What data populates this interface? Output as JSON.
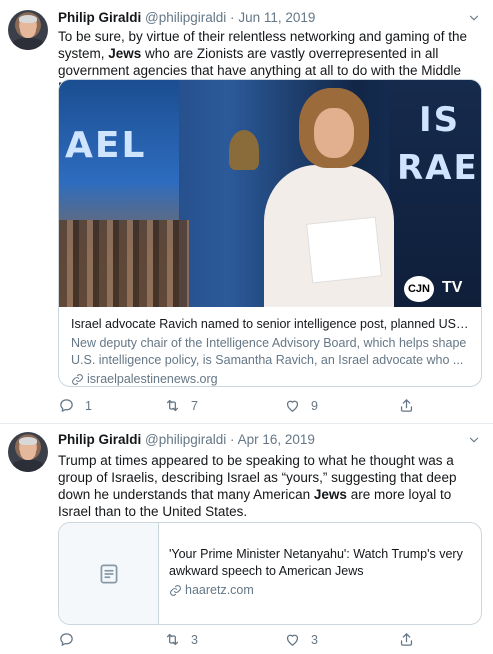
{
  "tweets": [
    {
      "author_name": "Philip Giraldi",
      "handle": "@philipgiraldi",
      "separator": "·",
      "date": "Jun 11, 2019",
      "text_parts": [
        "To be sure, by virtue of their relentless networking and gaming of the system, ",
        "Jews",
        " who are Zionists are vastly overrepresented in all government agencies that have anything at all to do with the Middle East."
      ],
      "card": {
        "image_text_left": "AEL",
        "image_text_right_top": "IS",
        "image_text_right_bottom": "RAE",
        "logo_left": "CJN",
        "logo_right": "TV",
        "title": "Israel advocate Ravich named to senior intelligence post, planned US-Is...",
        "description": "New deputy chair of the Intelligence Advisory Board, which helps shape U.S. intelligence policy, is Samantha Ravich, an Israel advocate who ...",
        "domain": "israelpalestinenews.org"
      },
      "actions": {
        "replies": "1",
        "retweets": "7",
        "likes": "9"
      }
    },
    {
      "author_name": "Philip Giraldi",
      "handle": "@philipgiraldi",
      "separator": "·",
      "date": "Apr 16, 2019",
      "text_parts": [
        "Trump at times appeared to be speaking to what he thought was a group of Israelis, describing Israel as “yours,” suggesting that deep down he understands that many American ",
        "Jews",
        " are more loyal to Israel than to the United States."
      ],
      "card": {
        "title": "'Your Prime Minister Netanyahu': Watch Trump's very awkward speech to American Jews",
        "domain": "haaretz.com"
      },
      "actions": {
        "replies": "",
        "retweets": "3",
        "likes": "3"
      }
    }
  ],
  "colors": {
    "text": "#14171a",
    "secondary": "#657786",
    "border": "#ccd6dd",
    "divider": "#e6ecf0"
  }
}
